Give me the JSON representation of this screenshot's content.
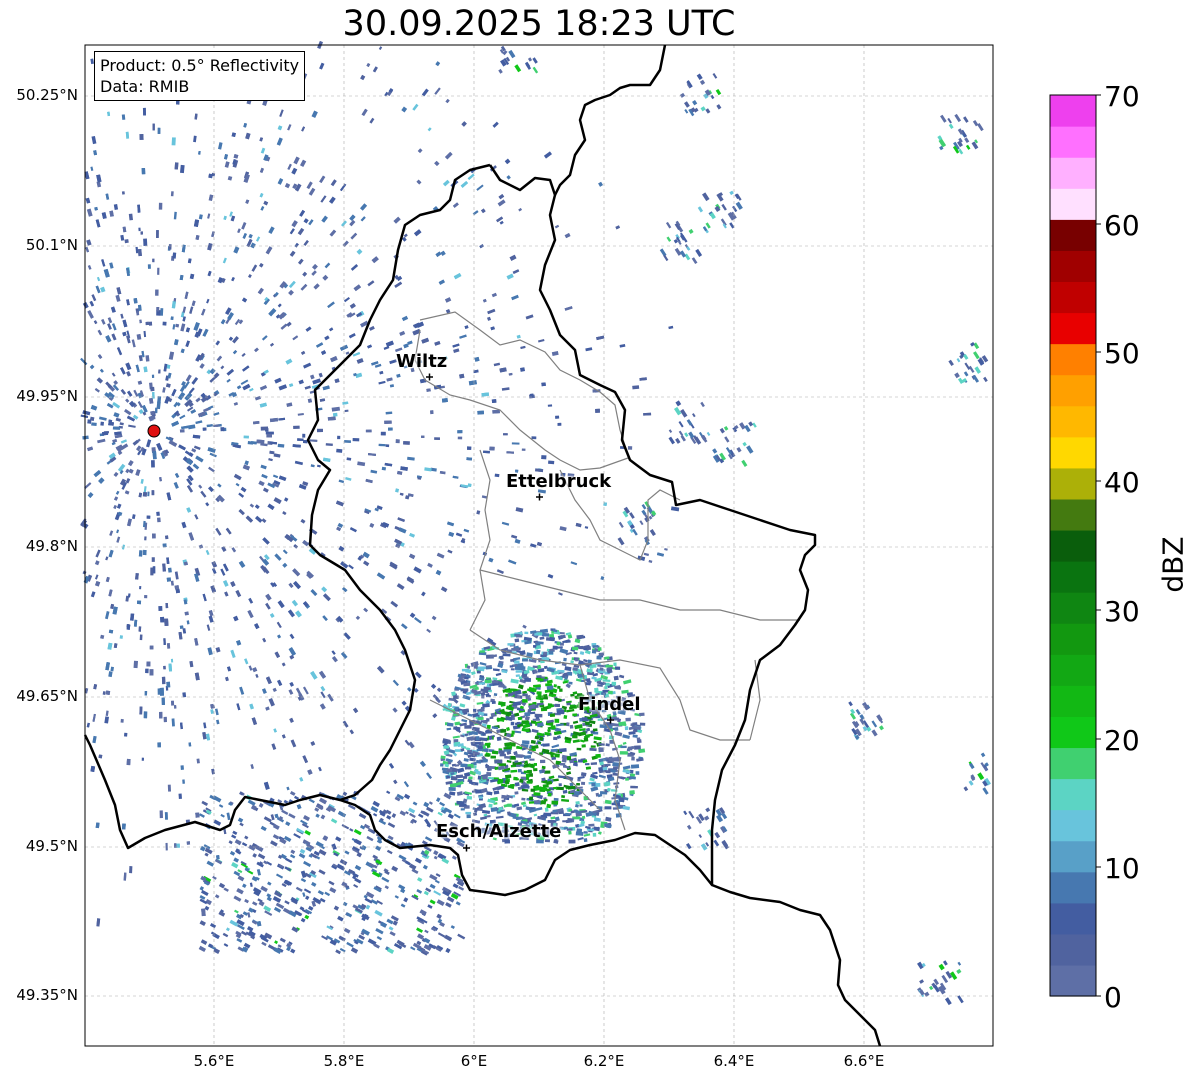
{
  "title": "30.09.2025 18:23 UTC",
  "info": {
    "product": "Product: 0.5° Reflectivity",
    "data": "Data: RMIB"
  },
  "axes": {
    "lat_ticks": [
      "50.25°N",
      "50.1°N",
      "49.95°N",
      "49.8°N",
      "49.65°N",
      "49.5°N",
      "49.35°N"
    ],
    "lon_ticks": [
      "5.6°E",
      "5.8°E",
      "6°E",
      "6.2°E",
      "6.4°E",
      "6.6°E"
    ],
    "grid": true
  },
  "cities": [
    {
      "name": "Wiltz"
    },
    {
      "name": "Ettelbruck"
    },
    {
      "name": "Findel"
    },
    {
      "name": "Esch/Alzette"
    }
  ],
  "radar_site_color": "#e01010",
  "colorbar": {
    "label": "dBZ",
    "ticks": [
      "0",
      "10",
      "20",
      "30",
      "40",
      "50",
      "60",
      "70"
    ],
    "min": 0,
    "max": 70,
    "colors": [
      "#5e6fa6",
      "#50639f",
      "#435da1",
      "#4778b0",
      "#58a0c8",
      "#68c4dc",
      "#5cd4c4",
      "#40d070",
      "#10c818",
      "#12b814",
      "#12a814",
      "#129810",
      "#0f8612",
      "#0a7410",
      "#0a5e0c",
      "#447a10",
      "#acb008",
      "#ffd800",
      "#ffb800",
      "#ffa000",
      "#ff8000",
      "#e80000",
      "#c00000",
      "#a00000",
      "#780000",
      "#ffe0ff",
      "#ffb0ff",
      "#ff70ff",
      "#ee40ee"
    ]
  }
}
